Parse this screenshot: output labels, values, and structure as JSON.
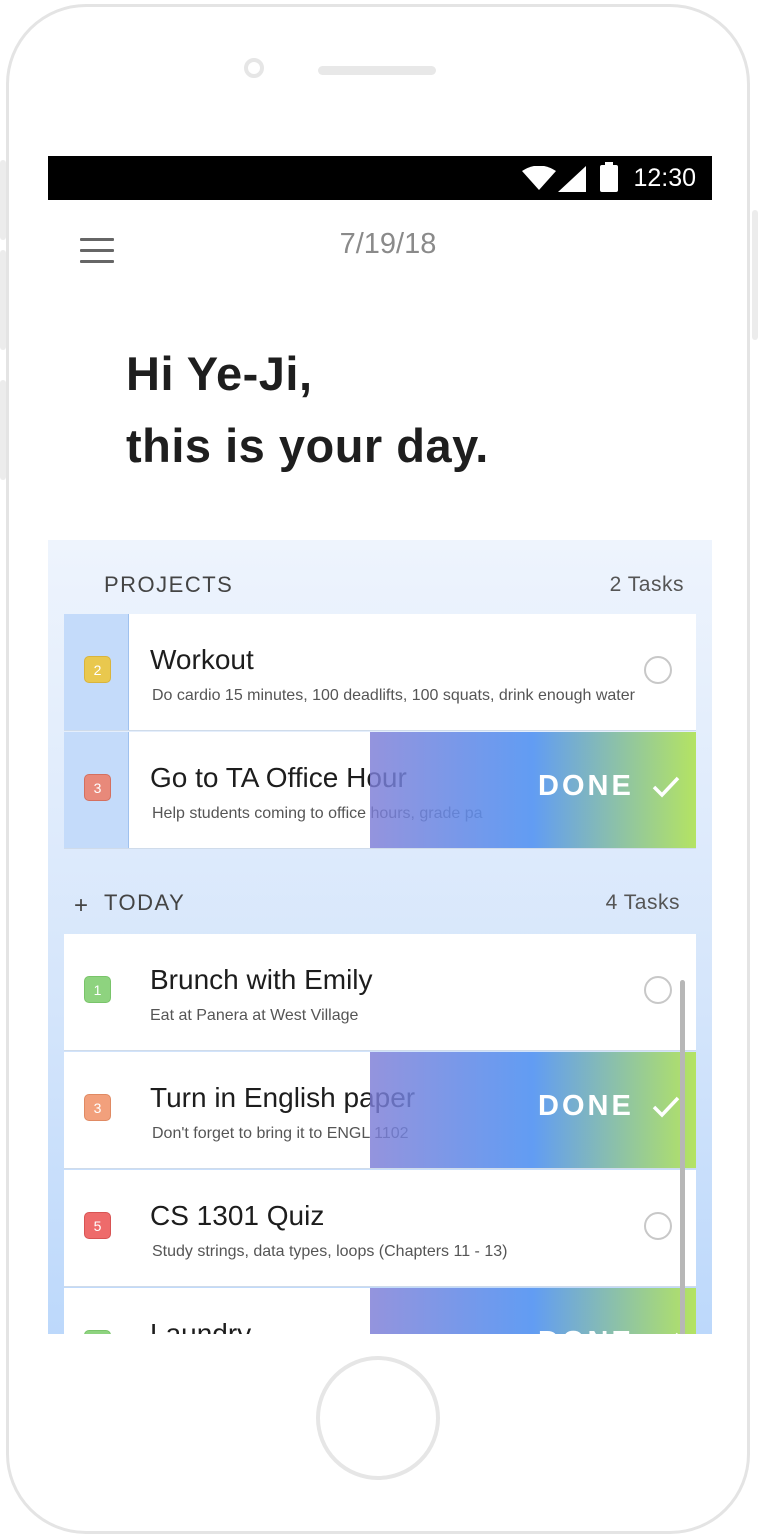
{
  "status_bar": {
    "time": "12:30",
    "icons": [
      "wifi-icon",
      "cell-signal-icon",
      "battery-icon"
    ]
  },
  "header": {
    "date": "7/19/18",
    "menu_icon": "hamburger-menu-icon"
  },
  "greeting": {
    "line1": "Hi Ye-Ji,",
    "line2": "this is your day."
  },
  "projects": {
    "title": "PROJECTS",
    "count": "2 Tasks",
    "items": [
      {
        "priority": "2",
        "title": "Workout",
        "subtitle": "Do cardio 15 minutes, 100 deadlifts, 100 squats, drink enough water",
        "state": "open",
        "badge_color": "#e9c84e"
      },
      {
        "priority": "3",
        "title": "Go to TA Office Hour",
        "subtitle": "Help students coming to office hours, grade pa",
        "state": "swiped-done",
        "done_label": "DONE",
        "badge_color": "#e8897a"
      }
    ]
  },
  "today": {
    "add_icon": "+",
    "title": "TODAY",
    "count": "4 Tasks",
    "items": [
      {
        "priority": "1",
        "title": "Brunch with Emily",
        "subtitle": "Eat at Panera at West Village",
        "state": "open",
        "badge_color": "#8ed37f"
      },
      {
        "priority": "3",
        "title": "Turn in English paper",
        "subtitle": "Don't forget to bring it to ENGL 1102",
        "state": "swiped-done",
        "done_label": "DONE",
        "badge_color": "#f2a07c"
      },
      {
        "priority": "5",
        "title": "CS 1301 Quiz",
        "subtitle": "Study strings, data types, loops (Chapters 11 - 13)",
        "state": "open",
        "badge_color": "#ee6b6b"
      },
      {
        "priority": "",
        "title": "Laundry",
        "subtitle": "",
        "state": "swiped-done",
        "done_label": "DONE",
        "badge_color": "#8ed37f"
      }
    ]
  },
  "colors": {
    "accent_blue": "#5494f2",
    "accent_green": "#b0e25a",
    "list_background": "#d6e6fb"
  }
}
